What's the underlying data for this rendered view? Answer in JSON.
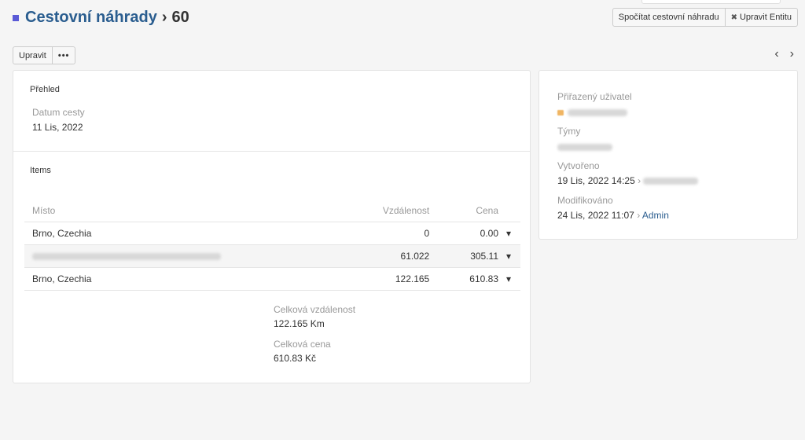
{
  "header": {
    "entity": "Cestovní náhrady",
    "separator": "›",
    "record_id": "60",
    "actions": {
      "calculate": "Spočítat cestovní náhradu",
      "edit_entity": "Upravit Entitu"
    }
  },
  "toolbar": {
    "edit": "Upravit",
    "more": "•••"
  },
  "pager": {
    "prev": "‹",
    "next": "›"
  },
  "overview": {
    "section": "Přehled",
    "trip_date_label": "Datum cesty",
    "trip_date_value": "11 Lis, 2022"
  },
  "items": {
    "section": "Items",
    "columns": [
      "Místo",
      "Vzdálenost",
      "Cena"
    ],
    "rows": [
      {
        "place": "Brno, Czechia",
        "distance": "0",
        "price": "0.00"
      },
      {
        "place": "",
        "distance": "61.022",
        "price": "305.11"
      },
      {
        "place": "Brno, Czechia",
        "distance": "122.165",
        "price": "610.83"
      }
    ],
    "caret": "▾"
  },
  "totals": {
    "distance_label": "Celková vzdálenost",
    "distance_value": "122.165 Km",
    "price_label": "Celková cena",
    "price_value": "610.83 Kč"
  },
  "sidebar": {
    "assigned_label": "Přiřazený uživatel",
    "teams_label": "Týmy",
    "created_label": "Vytvořeno",
    "created_value": "19 Lis, 2022 14:25",
    "modified_label": "Modifikováno",
    "modified_value": "24 Lis, 2022 11:07",
    "modified_by": "Admin",
    "arrow": "›"
  },
  "colors": {
    "title_link": "#2a5d8f",
    "title_square": "#5a5ad6"
  }
}
